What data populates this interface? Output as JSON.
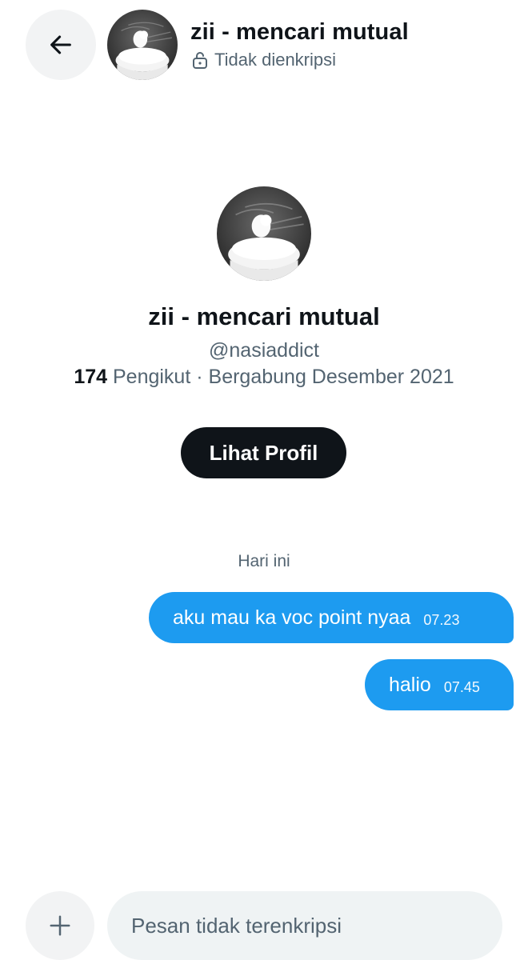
{
  "header": {
    "title": "zii - mencari mutual",
    "encryption_status": "Tidak dienkripsi"
  },
  "profile": {
    "name": "zii - mencari mutual",
    "handle": "@nasiaddict",
    "followers_count": "174",
    "followers_label": "Pengikut",
    "separator": "·",
    "joined": "Bergabung Desember 2021",
    "view_profile_label": "Lihat Profil"
  },
  "conversation": {
    "date_divider": "Hari ini",
    "messages": [
      {
        "text": "aku mau ka voc point nyaa",
        "time": "07.23"
      },
      {
        "text": "halio",
        "time": "07.45"
      }
    ]
  },
  "composer": {
    "placeholder": "Pesan tidak terenkripsi"
  },
  "colors": {
    "accent": "#1d9bf0",
    "primary_button": "#0f1419",
    "secondary_text": "#536471"
  }
}
